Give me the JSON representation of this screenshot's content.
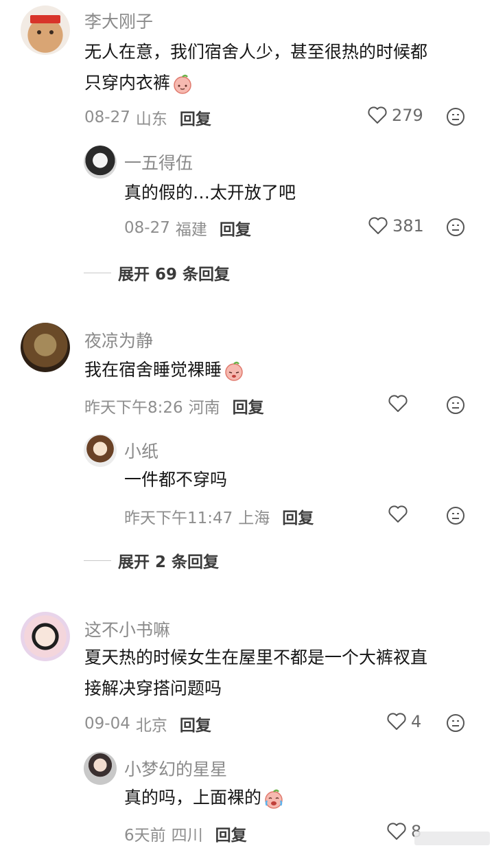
{
  "comments": [
    {
      "user": "李大刚子",
      "text_lines": [
        "无人在意，我们宿舍人少，甚至很热的时候都",
        "只穿内衣裤"
      ],
      "date": "08-27",
      "location": "山东",
      "reply_label": "回复",
      "likes": "279",
      "replies": [
        {
          "user": "一五得伍",
          "text": "真的假的…太开放了吧",
          "date": "08-27",
          "location": "福建",
          "reply_label": "回复",
          "likes": "381"
        }
      ],
      "expand_label": "展开 69 条回复"
    },
    {
      "user": "夜凉为静",
      "text_lines": [
        "我在宿舍睡觉裸睡"
      ],
      "date": "昨天下午8:26",
      "location": "河南",
      "reply_label": "回复",
      "likes": "",
      "replies": [
        {
          "user": "小纸",
          "text": "一件都不穿吗",
          "date": "昨天下午11:47",
          "location": "上海",
          "reply_label": "回复",
          "likes": ""
        }
      ],
      "expand_label": "展开 2 条回复"
    },
    {
      "user": "这不小书嘛",
      "text_lines": [
        "夏天热的时候女生在屋里不都是一个大裤衩直",
        "接解决穿搭问题吗"
      ],
      "date": "09-04",
      "location": "北京",
      "reply_label": "回复",
      "likes": "4",
      "replies": [
        {
          "user": "小梦幻的星星",
          "text": "真的吗，上面裸的",
          "date": "6天前",
          "location": "四川",
          "reply_label": "回复",
          "likes": "8"
        }
      ]
    }
  ],
  "icons": {
    "like": "heart-outline-icon",
    "dislike": "neutral-face-icon"
  },
  "colors": {
    "username": "#8a8a8a",
    "meta": "#8e8e8e",
    "text": "#161616"
  }
}
